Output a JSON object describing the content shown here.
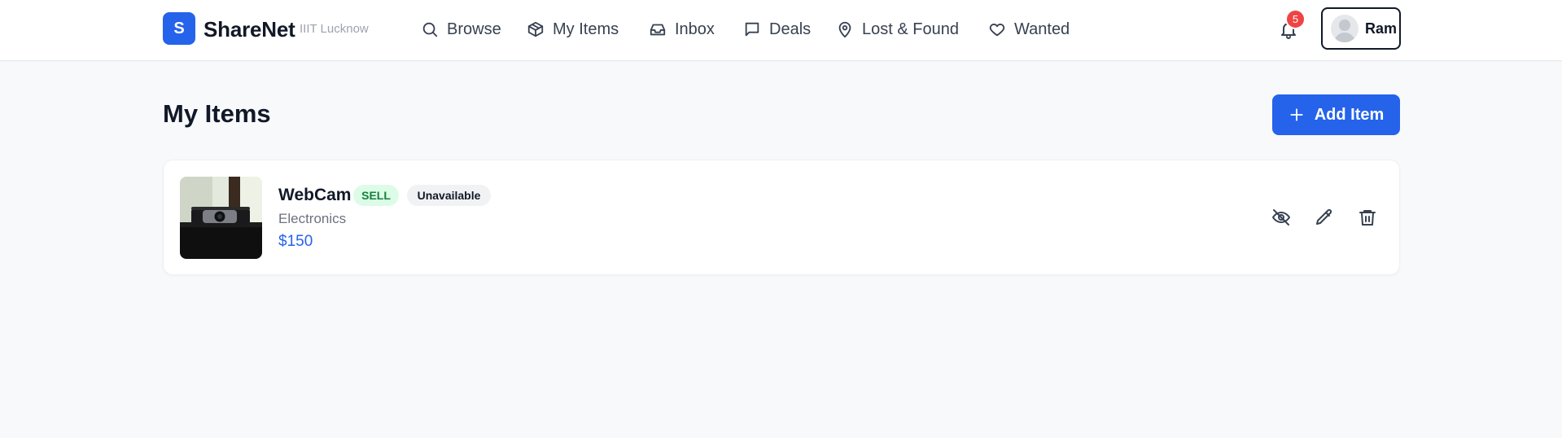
{
  "header": {
    "logo_letter": "S",
    "brand": "ShareNet",
    "campus": "IIIT Lucknow",
    "nav": [
      {
        "label": "Browse",
        "icon": "search-icon"
      },
      {
        "label": "My Items",
        "icon": "box-icon"
      },
      {
        "label": "Inbox",
        "icon": "inbox-icon"
      },
      {
        "label": "Deals",
        "icon": "message-icon"
      },
      {
        "label": "Lost & Found",
        "icon": "map-pin-icon"
      },
      {
        "label": "Wanted",
        "icon": "heart-icon"
      }
    ],
    "notification_count": "5",
    "user_name": "Ram"
  },
  "main": {
    "title": "My Items",
    "add_button": "Add Item",
    "items": [
      {
        "name": "WebCam",
        "type_tag": "SELL",
        "status_tag": "Unavailable",
        "category": "Electronics",
        "price": "$150",
        "actions": [
          "eye-off-icon",
          "pencil-icon",
          "trash-icon"
        ]
      }
    ]
  },
  "colors": {
    "primary": "#2563eb",
    "sell_tag_bg": "#dcfce7",
    "sell_tag_text": "#15803d",
    "badge": "#ef4444"
  }
}
